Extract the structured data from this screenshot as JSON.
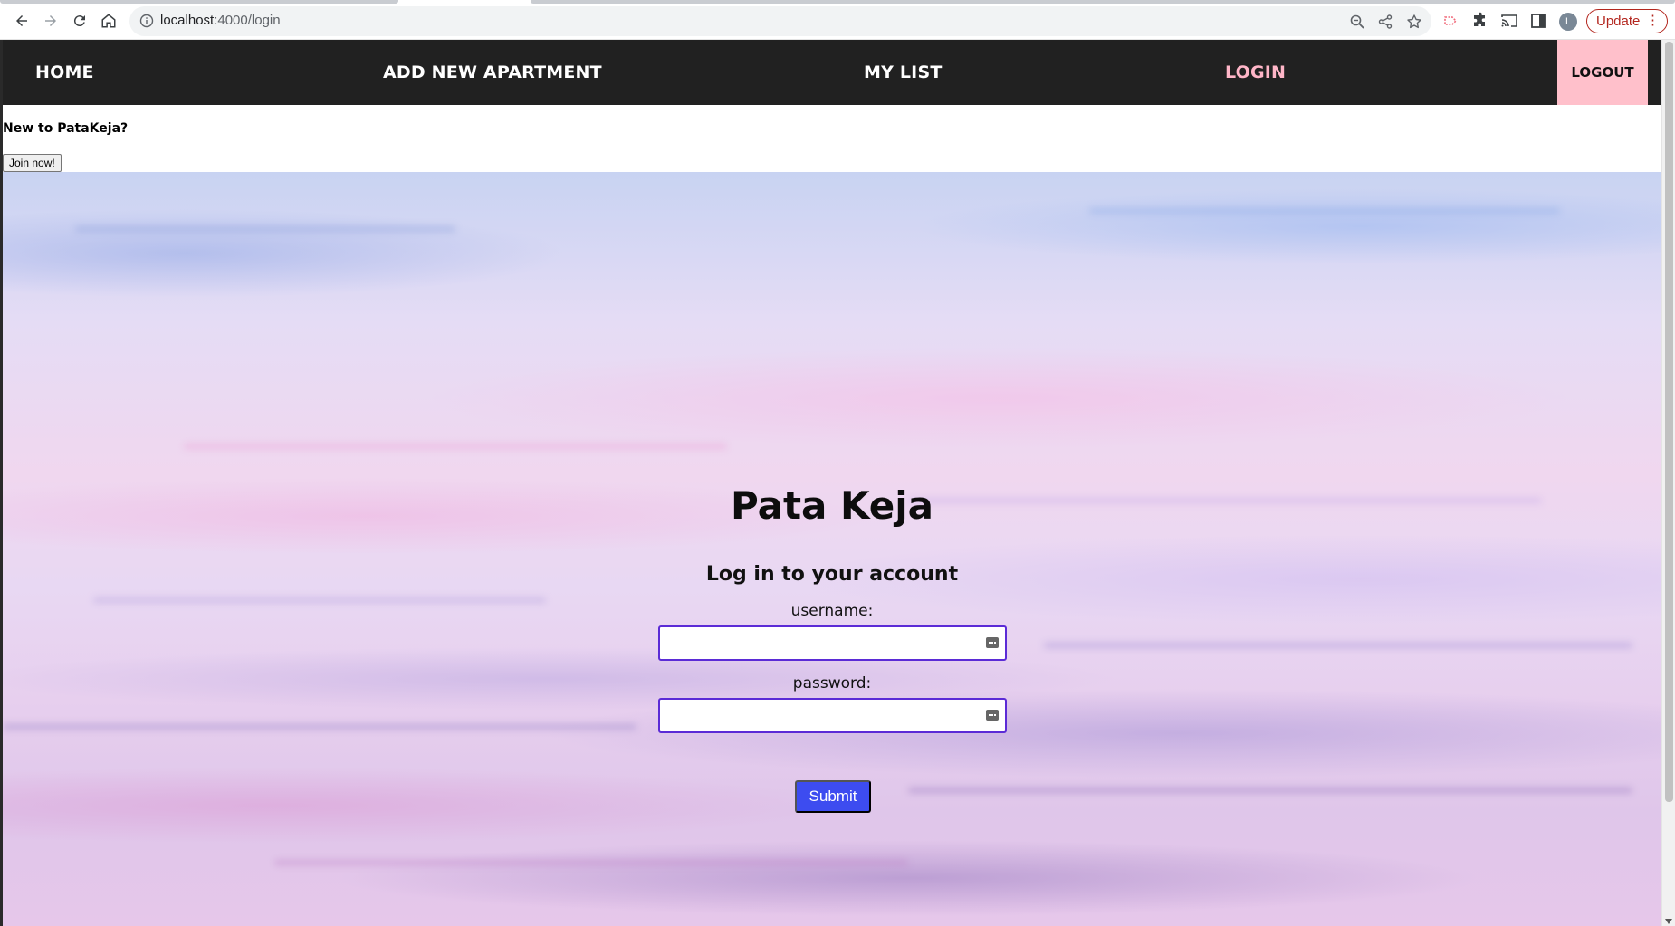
{
  "browser": {
    "url_host": "localhost",
    "url_path": ":4000/login",
    "profile_initial": "L",
    "update_label": "Update"
  },
  "navbar": {
    "items": [
      {
        "label": "HOME",
        "active": false
      },
      {
        "label": "ADD NEW APARTMENT",
        "active": false
      },
      {
        "label": "MY LIST",
        "active": false
      },
      {
        "label": "LOGIN",
        "active": true
      }
    ],
    "logout_label": "LOGOUT"
  },
  "signup": {
    "prompt": "New to PataKeja?",
    "join_label": "Join now!"
  },
  "login": {
    "site_title": "Pata Keja",
    "form_title": "Log in to your account",
    "username_label": "username:",
    "username_value": "",
    "password_label": "password:",
    "password_value": "",
    "submit_label": "Submit"
  },
  "colors": {
    "navbar_bg": "#212121",
    "active_link": "#ffb6c8",
    "logout_bg": "#ffc0cb",
    "submit_bg": "#3d4cf0",
    "input_border": "#5b2bd6"
  }
}
